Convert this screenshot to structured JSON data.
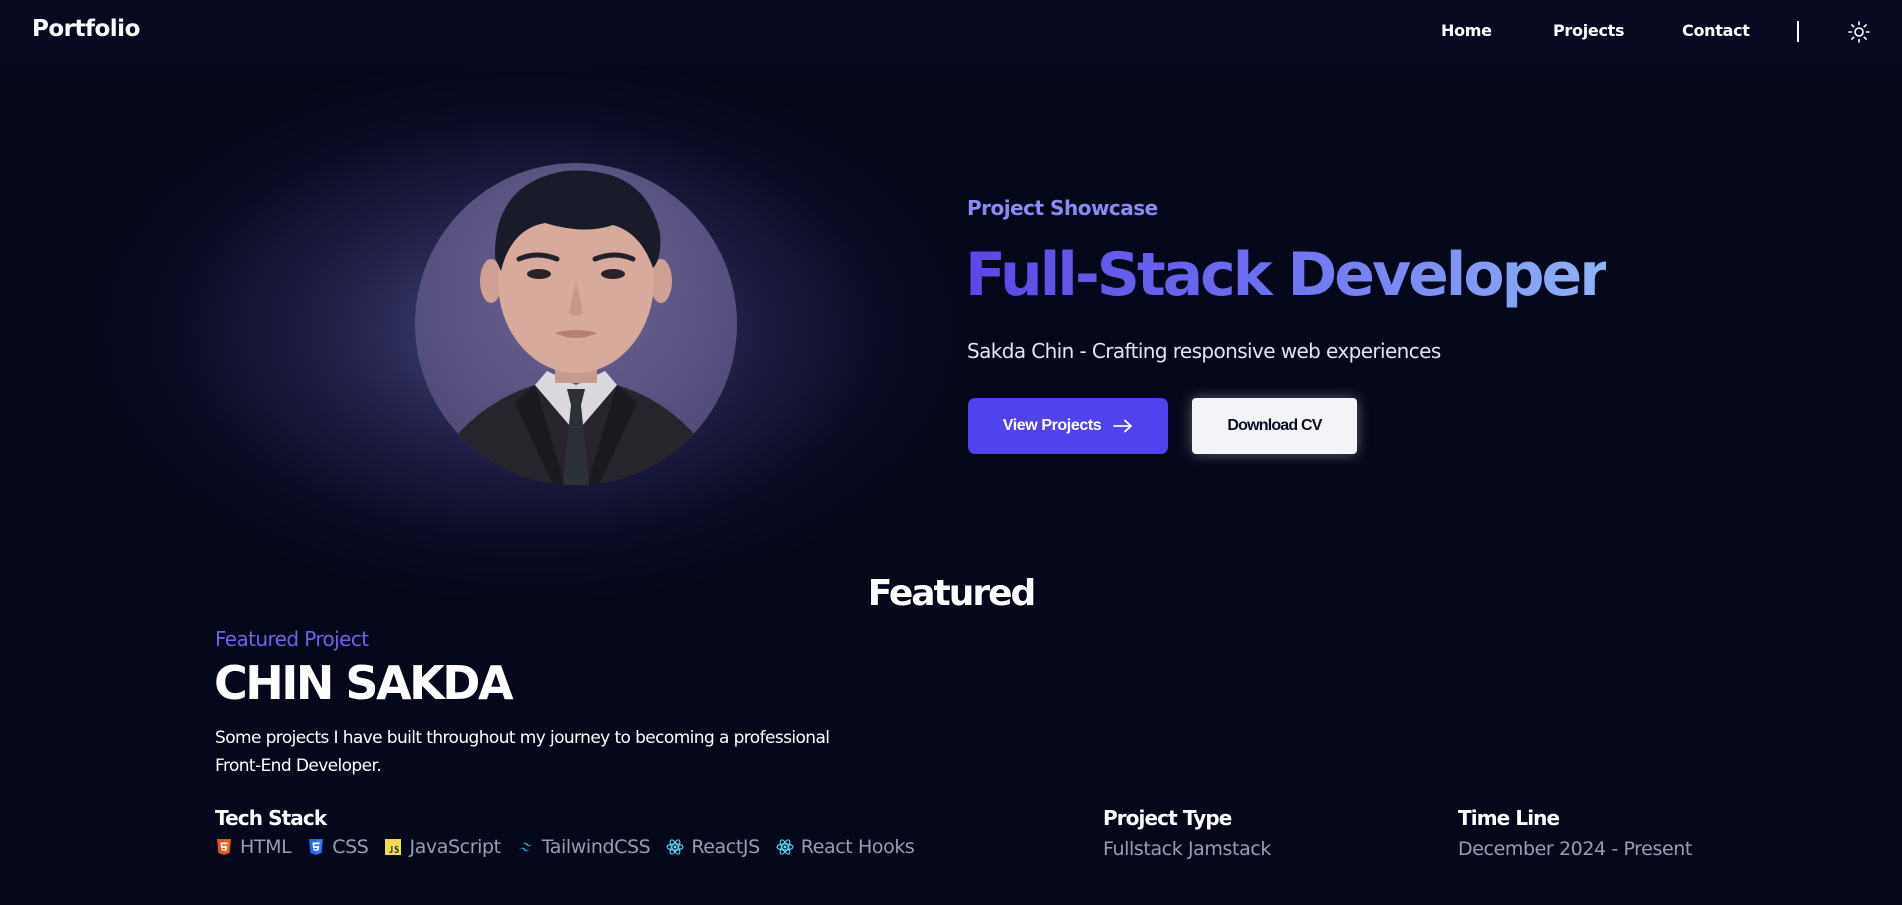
{
  "nav": {
    "brand": "Portfolio",
    "links": [
      "Home",
      "Projects",
      "Contact"
    ],
    "theme_icon": "sun-icon"
  },
  "hero": {
    "eyebrow": "Project Showcase",
    "title": "Full-Stack Developer",
    "subtitle": "Sakda Chin - Crafting responsive web experiences",
    "primary_button": "View Projects",
    "primary_button_icon": "arrow-right-icon",
    "secondary_button": "Download CV",
    "avatar_icon": "profile-photo"
  },
  "featured": {
    "section_title": "Featured",
    "eyebrow": "Featured Project",
    "title": "CHIN SAKDA",
    "description": "Some projects I have built throughout my journey to becoming a professional Front-End Developer.",
    "tech_stack": {
      "label": "Tech Stack",
      "items": [
        {
          "name": "HTML",
          "icon": "html5-icon",
          "color": "#e44d26"
        },
        {
          "name": "CSS",
          "icon": "css3-icon",
          "color": "#2965f1"
        },
        {
          "name": "JavaScript",
          "icon": "javascript-icon",
          "color": "#f0db4f"
        },
        {
          "name": "TailwindCSS",
          "icon": "tailwind-icon",
          "color": "#38bdf8"
        },
        {
          "name": "ReactJS",
          "icon": "react-icon",
          "color": "#61dafb"
        },
        {
          "name": "React Hooks",
          "icon": "react-icon",
          "color": "#61dafb"
        }
      ]
    },
    "project_type": {
      "label": "Project Type",
      "value": "Fullstack Jamstack"
    },
    "timeline": {
      "label": "Time Line",
      "value": "December 2024 - Present"
    }
  },
  "colors": {
    "background": "#05071a",
    "accent": "#5043ef",
    "eyebrow": "#8b8cf3",
    "muted": "#9a9cb3"
  }
}
